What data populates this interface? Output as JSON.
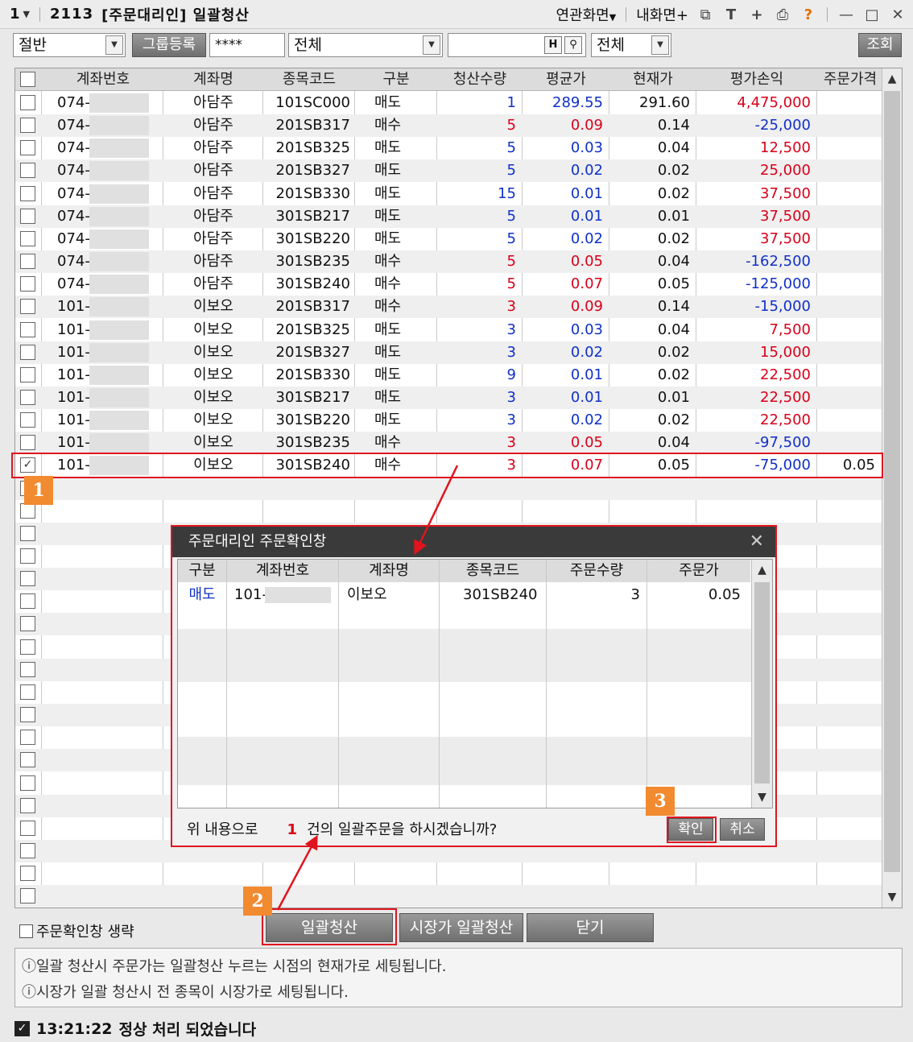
{
  "titlebar": {
    "window_num": "1",
    "screen_code": "2113",
    "title": "[주문대리인] 일괄청산",
    "related_screens": "연관화면",
    "my_screen": "내화면"
  },
  "toolbar": {
    "qty_mode": "절반",
    "group_register": "그룹등록",
    "password": "****",
    "filter1": "전체",
    "code_input": "",
    "filter2": "전체",
    "search_button": "조회"
  },
  "table": {
    "columns": [
      "계좌번호",
      "계좌명",
      "종목코드",
      "구분",
      "청산수량",
      "평균가",
      "현재가",
      "평가손익",
      "주문가격"
    ],
    "rows": [
      {
        "account": "074-",
        "name": "아담주",
        "code": "101SC000",
        "side": "매도",
        "qty": "1",
        "avg": "289.55",
        "cur": "291.60",
        "pnl": "4,475,000",
        "order": "",
        "checked": false
      },
      {
        "account": "074-",
        "name": "아담주",
        "code": "201SB317",
        "side": "매수",
        "qty": "5",
        "avg": "0.09",
        "cur": "0.14",
        "pnl": "-25,000",
        "order": "",
        "checked": false
      },
      {
        "account": "074-",
        "name": "아담주",
        "code": "201SB325",
        "side": "매도",
        "qty": "5",
        "avg": "0.03",
        "cur": "0.04",
        "pnl": "12,500",
        "order": "",
        "checked": false
      },
      {
        "account": "074-",
        "name": "아담주",
        "code": "201SB327",
        "side": "매도",
        "qty": "5",
        "avg": "0.02",
        "cur": "0.02",
        "pnl": "25,000",
        "order": "",
        "checked": false
      },
      {
        "account": "074-",
        "name": "아담주",
        "code": "201SB330",
        "side": "매도",
        "qty": "15",
        "avg": "0.01",
        "cur": "0.02",
        "pnl": "37,500",
        "order": "",
        "checked": false
      },
      {
        "account": "074-",
        "name": "아담주",
        "code": "301SB217",
        "side": "매도",
        "qty": "5",
        "avg": "0.01",
        "cur": "0.01",
        "pnl": "37,500",
        "order": "",
        "checked": false
      },
      {
        "account": "074-",
        "name": "아담주",
        "code": "301SB220",
        "side": "매도",
        "qty": "5",
        "avg": "0.02",
        "cur": "0.02",
        "pnl": "37,500",
        "order": "",
        "checked": false
      },
      {
        "account": "074-",
        "name": "아담주",
        "code": "301SB235",
        "side": "매수",
        "qty": "5",
        "avg": "0.05",
        "cur": "0.04",
        "pnl": "-162,500",
        "order": "",
        "checked": false
      },
      {
        "account": "074-",
        "name": "아담주",
        "code": "301SB240",
        "side": "매수",
        "qty": "5",
        "avg": "0.07",
        "cur": "0.05",
        "pnl": "-125,000",
        "order": "",
        "checked": false
      },
      {
        "account": "101-",
        "name": "이보오",
        "code": "201SB317",
        "side": "매수",
        "qty": "3",
        "avg": "0.09",
        "cur": "0.14",
        "pnl": "-15,000",
        "order": "",
        "checked": false
      },
      {
        "account": "101-",
        "name": "이보오",
        "code": "201SB325",
        "side": "매도",
        "qty": "3",
        "avg": "0.03",
        "cur": "0.04",
        "pnl": "7,500",
        "order": "",
        "checked": false
      },
      {
        "account": "101-",
        "name": "이보오",
        "code": "201SB327",
        "side": "매도",
        "qty": "3",
        "avg": "0.02",
        "cur": "0.02",
        "pnl": "15,000",
        "order": "",
        "checked": false
      },
      {
        "account": "101-",
        "name": "이보오",
        "code": "201SB330",
        "side": "매도",
        "qty": "9",
        "avg": "0.01",
        "cur": "0.02",
        "pnl": "22,500",
        "order": "",
        "checked": false
      },
      {
        "account": "101-",
        "name": "이보오",
        "code": "301SB217",
        "side": "매도",
        "qty": "3",
        "avg": "0.01",
        "cur": "0.01",
        "pnl": "22,500",
        "order": "",
        "checked": false
      },
      {
        "account": "101-",
        "name": "이보오",
        "code": "301SB220",
        "side": "매도",
        "qty": "3",
        "avg": "0.02",
        "cur": "0.02",
        "pnl": "22,500",
        "order": "",
        "checked": false
      },
      {
        "account": "101-",
        "name": "이보오",
        "code": "301SB235",
        "side": "매수",
        "qty": "3",
        "avg": "0.05",
        "cur": "0.04",
        "pnl": "-97,500",
        "order": "",
        "checked": false
      },
      {
        "account": "101-",
        "name": "이보오",
        "code": "301SB240",
        "side": "매수",
        "qty": "3",
        "avg": "0.07",
        "cur": "0.05",
        "pnl": "-75,000",
        "order": "0.05",
        "checked": true
      }
    ]
  },
  "dialog": {
    "title": "주문대리인 주문확인창",
    "columns": [
      "구분",
      "계좌번호",
      "계좌명",
      "종목코드",
      "주문수량",
      "주문가"
    ],
    "row": {
      "side": "매도",
      "account": "101-",
      "name": "이보오",
      "code": "301SB240",
      "qty": "3",
      "price": "0.05"
    },
    "msg_prefix": "위 내용으로",
    "count": "1",
    "msg_suffix": "건의 일괄주문을 하시겠습니까?",
    "confirm": "확인",
    "cancel": "취소"
  },
  "bottom": {
    "skip_label": "주문확인창 생략",
    "bulk_clear": "일괄청산",
    "market_bulk_clear": "시장가 일괄청산",
    "close": "닫기",
    "note1": "일괄 청산시 주문가는 일괄청산 누르는 시점의 현재가로 세팅됩니다.",
    "note2": "시장가 일괄 청산시 전 종목이 시장가로 세팅됩니다."
  },
  "status": {
    "time": "13:21:22",
    "message": "정상 처리 되었습니다"
  },
  "badges": [
    "1",
    "2",
    "3"
  ],
  "colors": {
    "sell": "#1030c8",
    "buy": "#d8001a",
    "highlight": "#e0141e",
    "badge": "#f28a30"
  }
}
